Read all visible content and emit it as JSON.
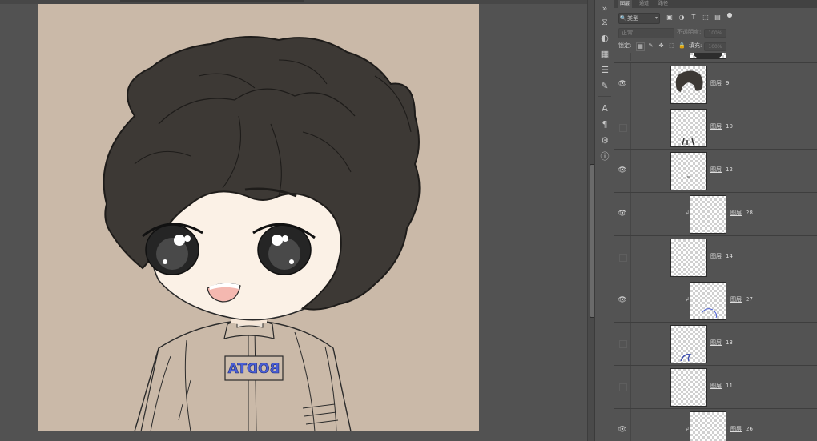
{
  "tabs": [
    "图层",
    "通道",
    "路径"
  ],
  "filter": {
    "kind_label": "类型",
    "search_glyph": "🔍"
  },
  "blend": {
    "mode": "正常",
    "opacity_label": "不透明度:",
    "opacity_value": "100%"
  },
  "lock": {
    "label": "锁定:",
    "fill_label": "填充:",
    "fill_value": "100%"
  },
  "canvas_text": {
    "badge": "BODTA"
  },
  "layers": [
    {
      "name": "图层",
      "num": "9",
      "visible": true,
      "clipped": false
    },
    {
      "name": "图层",
      "num": "10",
      "visible": false,
      "clipped": false
    },
    {
      "name": "图层",
      "num": "12",
      "visible": true,
      "clipped": false
    },
    {
      "name": "图层",
      "num": "28",
      "visible": true,
      "clipped": true
    },
    {
      "name": "图层",
      "num": "14",
      "visible": false,
      "clipped": false
    },
    {
      "name": "图层",
      "num": "27",
      "visible": true,
      "clipped": true
    },
    {
      "name": "图层",
      "num": "13",
      "visible": false,
      "clipped": false
    },
    {
      "name": "图层",
      "num": "11",
      "visible": false,
      "clipped": false
    },
    {
      "name": "图层",
      "num": "26",
      "visible": true,
      "clipped": true
    }
  ],
  "colors": {
    "canvas": "#cab9a8",
    "hair": "#3d3935",
    "skin": "#fbf1e6",
    "badge_text": "#4a5fd6",
    "panel": "#535353"
  }
}
